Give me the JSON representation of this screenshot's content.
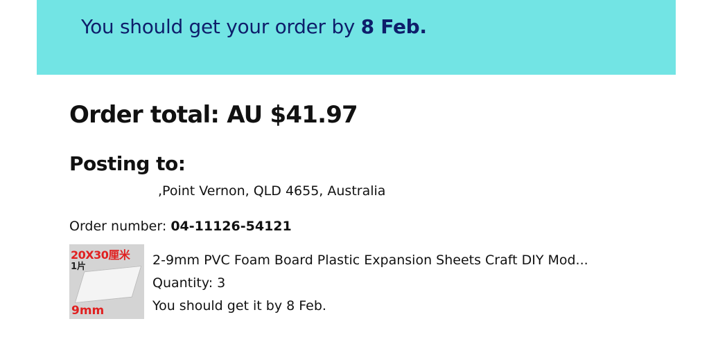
{
  "banner": {
    "prefix": "You should get your order by ",
    "date": "8 Feb.",
    "background_color": "#72e4e4",
    "text_color": "#0e1e6b"
  },
  "order": {
    "total_label": "Order total:",
    "total_value": "AU $41.97",
    "posting_label": "Posting to:",
    "address": ",Point Vernon, QLD 4655, Australia",
    "number_label": "Order number:",
    "number_value": "04-11126-54121"
  },
  "item": {
    "title": "2-9mm PVC Foam Board Plastic Expansion Sheets Craft DIY Mod...",
    "quantity": "Quantity: 3",
    "delivery": "You should get it by 8 Feb.",
    "thumbnail": {
      "top_text": "20X30厘米",
      "sub_text": "1片",
      "bottom_text": "9mm"
    }
  }
}
